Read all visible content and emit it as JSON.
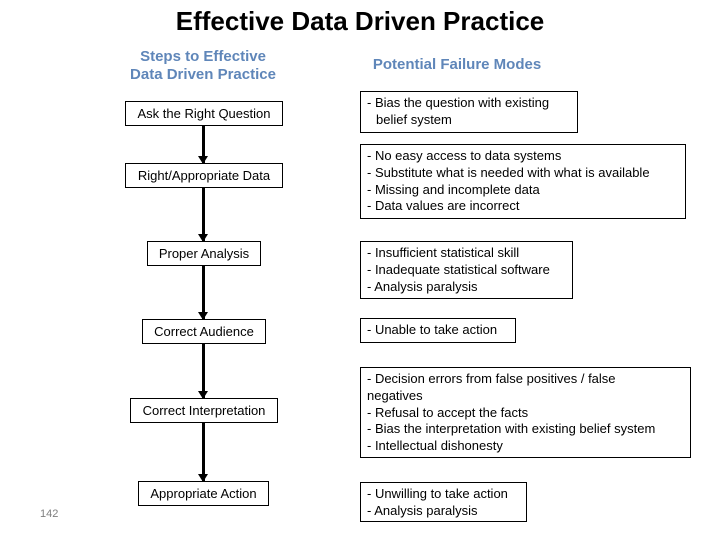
{
  "title": "Effective Data Driven Practice",
  "columns": {
    "steps_header": [
      "Steps to Effective",
      "Data Driven Practice"
    ],
    "failures_header": "Potential Failure Modes"
  },
  "steps": [
    {
      "label": "Ask the Right Question"
    },
    {
      "label": "Right/Appropriate Data"
    },
    {
      "label": "Proper Analysis"
    },
    {
      "label": "Correct Audience"
    },
    {
      "label": "Correct Interpretation"
    },
    {
      "label": "Appropriate Action"
    }
  ],
  "failure_modes": [
    {
      "lines": [
        "- Bias the question with existing",
        "  belief system"
      ]
    },
    {
      "lines": [
        "- No easy access to data systems",
        "- Substitute what is needed with what is available",
        "- Missing and incomplete data",
        "- Data values are incorrect"
      ]
    },
    {
      "lines": [
        "- Insufficient statistical skill",
        "- Inadequate statistical software",
        "- Analysis paralysis"
      ]
    },
    {
      "lines": [
        "- Unable to take action"
      ]
    },
    {
      "lines": [
        "- Decision errors from false positives / false",
        "negatives",
        "- Refusal to accept the facts",
        "- Bias the interpretation with existing belief system",
        "- Intellectual dishonesty"
      ]
    },
    {
      "lines": [
        "- Unwilling to take action",
        "- Analysis paralysis"
      ]
    }
  ],
  "page_number": "142",
  "colors": {
    "header_blue": "#5f86b9",
    "border": "#000000",
    "page_number_gray": "#7f7f7f"
  }
}
